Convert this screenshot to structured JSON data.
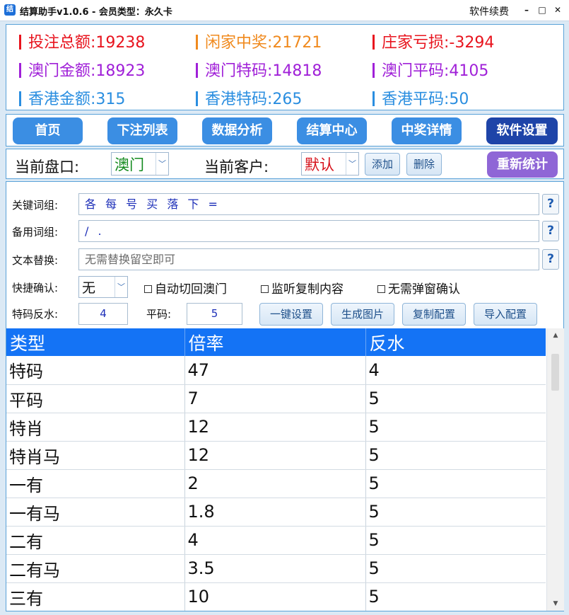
{
  "titlebar": {
    "title": "结算助手v1.0.6 - 会员类型：永久卡",
    "renew": "软件续费",
    "minimize": "–",
    "maximize": "□",
    "close": "✕"
  },
  "stats": [
    {
      "label": "投注总额:19238",
      "color": "#e8141e",
      "bar": "#e8141e"
    },
    {
      "label": "闲家中奖:21721",
      "color": "#f08a1e",
      "bar": "#f08a1e"
    },
    {
      "label": "庄家亏损:-3294",
      "color": "#e8141e",
      "bar": "#e8141e"
    },
    {
      "label": "澳门金额:18923",
      "color": "#a020d8",
      "bar": "#a020d8"
    },
    {
      "label": "澳门特码:14818",
      "color": "#a020d8",
      "bar": "#a020d8"
    },
    {
      "label": "澳门平码:4105",
      "color": "#a020d8",
      "bar": "#a020d8"
    },
    {
      "label": "香港金额:315",
      "color": "#2a8ee0",
      "bar": "#2a8ee0"
    },
    {
      "label": "香港特码:265",
      "color": "#2a8ee0",
      "bar": "#2a8ee0"
    },
    {
      "label": "香港平码:50",
      "color": "#2a8ee0",
      "bar": "#2a8ee0"
    }
  ],
  "nav": {
    "home": "首页",
    "bet_list": "下注列表",
    "analysis": "数据分析",
    "settlement": "结算中心",
    "prize": "中奖详情",
    "settings": "软件设置"
  },
  "selector": {
    "market_label": "当前盘口:",
    "market_value": "澳门",
    "customer_label": "当前客户:",
    "customer_value": "默认",
    "add": "添加",
    "delete": "删除",
    "recalc": "重新统计"
  },
  "settings": {
    "keyword_label": "关键词组:",
    "keyword_value": "各 每 号 买 落 下 =",
    "backup_label": "备用词组:",
    "backup_value": "/ .",
    "replace_label": "文本替换:",
    "replace_placeholder": "无需替换留空即可",
    "help": "?",
    "quick_label": "快捷确认:",
    "quick_value": "无",
    "auto_switch": "自动切回澳门",
    "listen_copy": "监听复制内容",
    "no_popup": "无需弹窗确认",
    "special_label": "特码反水:",
    "special_value": "4",
    "flat_label": "平码:",
    "flat_value": "5",
    "one_click": "一键设置",
    "gen_image": "生成图片",
    "copy_config": "复制配置",
    "import_config": "导入配置"
  },
  "table": {
    "headers": [
      "类型",
      "倍率",
      "反水"
    ],
    "rows": [
      [
        "特码",
        "47",
        "4"
      ],
      [
        "平码",
        "7",
        "5"
      ],
      [
        "特肖",
        "12",
        "5"
      ],
      [
        "特肖马",
        "12",
        "5"
      ],
      [
        "一有",
        "2",
        "5"
      ],
      [
        "一有马",
        "1.8",
        "5"
      ],
      [
        "二有",
        "4",
        "5"
      ],
      [
        "二有马",
        "3.5",
        "5"
      ],
      [
        "三有",
        "10",
        "5"
      ]
    ]
  }
}
